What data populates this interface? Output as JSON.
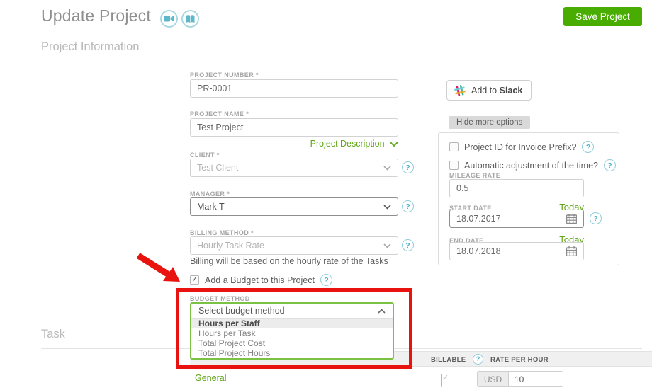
{
  "header": {
    "title": "Update Project",
    "save_button": "Save Project"
  },
  "sections": {
    "project_information": "Project Information",
    "task": "Task"
  },
  "form": {
    "project_number": {
      "label": "PROJECT NUMBER *",
      "value": "PR-0001"
    },
    "project_name": {
      "label": "PROJECT NAME *",
      "value": "Test Project"
    },
    "project_description_link": "Project Description",
    "client": {
      "label": "CLIENT *",
      "value": "Test Client"
    },
    "manager": {
      "label": "MANAGER *",
      "value": "Mark T"
    },
    "billing_method": {
      "label": "BILLING METHOD *",
      "value": "Hourly Task Rate",
      "note": "Billing will be based on the hourly rate of the Tasks"
    },
    "budget_checkbox": {
      "label": "Add a Budget to this Project",
      "checked": true
    },
    "budget_method": {
      "label": "BUDGET METHOD",
      "placeholder": "Select budget method",
      "options": [
        "Hours per Staff",
        "Hours per Task",
        "Total Project Cost",
        "Total Project Hours"
      ],
      "highlighted_option": "Hours per Staff"
    }
  },
  "right_panel": {
    "add_to_slack": {
      "prefix": "Add to",
      "brand": "Slack"
    },
    "hide_more_options": "Hide more options",
    "invoice_prefix_checkbox": {
      "label": "Project ID for Invoice Prefix?",
      "checked": false
    },
    "auto_adjust_checkbox": {
      "label": "Automatic adjustment of the time?",
      "checked": false
    },
    "mileage_rate": {
      "label": "MILEAGE RATE",
      "value": "0.5"
    },
    "start_date": {
      "label": "START DATE",
      "value": "18.07.2017",
      "today_link": "Today"
    },
    "end_date": {
      "label": "END DATE",
      "value": "18.07.2018",
      "today_link": "Today"
    }
  },
  "task_table": {
    "billable_header": "BILLABLE",
    "rate_header": "RATE PER HOUR",
    "row": {
      "name": "General",
      "billable_checked": true,
      "currency": "USD",
      "rate": "10"
    }
  },
  "colors": {
    "save_button_green": "#48ad00",
    "link_green": "#5fa616",
    "dropdown_border_green": "#7bc143",
    "annotation_red": "#e8120e",
    "icon_teal": "#5eb6c7"
  }
}
